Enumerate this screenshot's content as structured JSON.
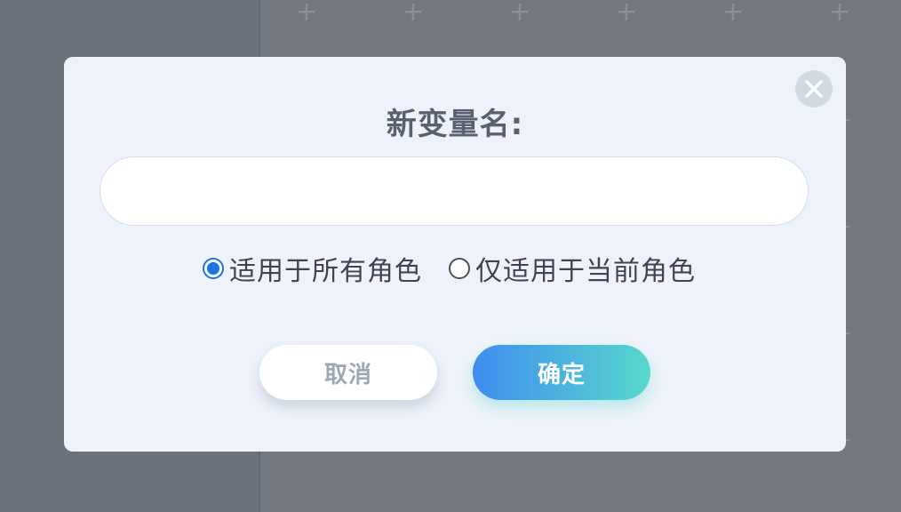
{
  "dialog": {
    "title": "新变量名:",
    "input": {
      "value": "",
      "placeholder": ""
    },
    "scope_options": [
      {
        "label": "适用于所有角色",
        "selected": true
      },
      {
        "label": "仅适用于当前角色",
        "selected": false
      }
    ],
    "cancel_label": "取消",
    "confirm_label": "确定",
    "close_icon": "close-icon"
  },
  "colors": {
    "accent": "#1a73e8",
    "confirm_gradient_start": "#3f8def",
    "confirm_gradient_end": "#58d8cc",
    "dialog_background": "#eef3fb",
    "overlay": "#727780"
  }
}
